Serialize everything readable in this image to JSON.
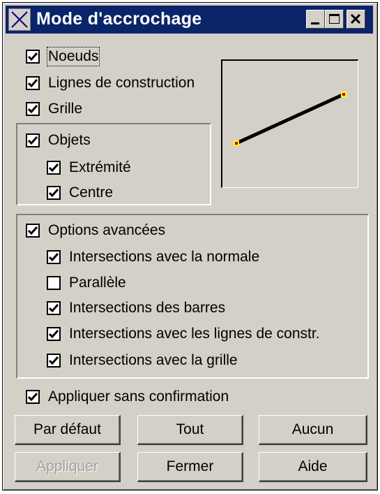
{
  "window": {
    "title": "Mode d'accrochage",
    "title_icon": "snap-cross-icon",
    "controls": [
      "minimize-icon",
      "maximize-icon",
      "close-icon"
    ]
  },
  "top_options": [
    {
      "label": "Noeuds",
      "checked": true
    },
    {
      "label": "Lignes de construction",
      "checked": true
    },
    {
      "label": "Grille",
      "checked": true
    }
  ],
  "objects": {
    "label": "Objets",
    "checked": true,
    "items": [
      {
        "label": "Extrémité",
        "checked": true
      },
      {
        "label": "Centre",
        "checked": true
      }
    ]
  },
  "advanced": {
    "label": "Options avancées",
    "checked": true,
    "items": [
      {
        "label": "Intersections avec la normale",
        "checked": true
      },
      {
        "label": "Parallèle",
        "checked": false
      },
      {
        "label": "Intersections des barres",
        "checked": true
      },
      {
        "label": "Intersections avec les lignes de constr.",
        "checked": true
      },
      {
        "label": "Intersections avec la grille",
        "checked": true
      }
    ]
  },
  "apply_without_confirm": {
    "label": "Appliquer sans confirmation",
    "checked": true
  },
  "buttons": {
    "default": "Par défaut",
    "all": "Tout",
    "none": "Aucun",
    "apply": "Appliquer",
    "close": "Fermer",
    "help": "Aide"
  },
  "colors": {
    "titlebar": "#0a246a",
    "face": "#d4d0c8",
    "endpoint_marker": "#ffff00",
    "endpoint_center": "#c00000"
  }
}
